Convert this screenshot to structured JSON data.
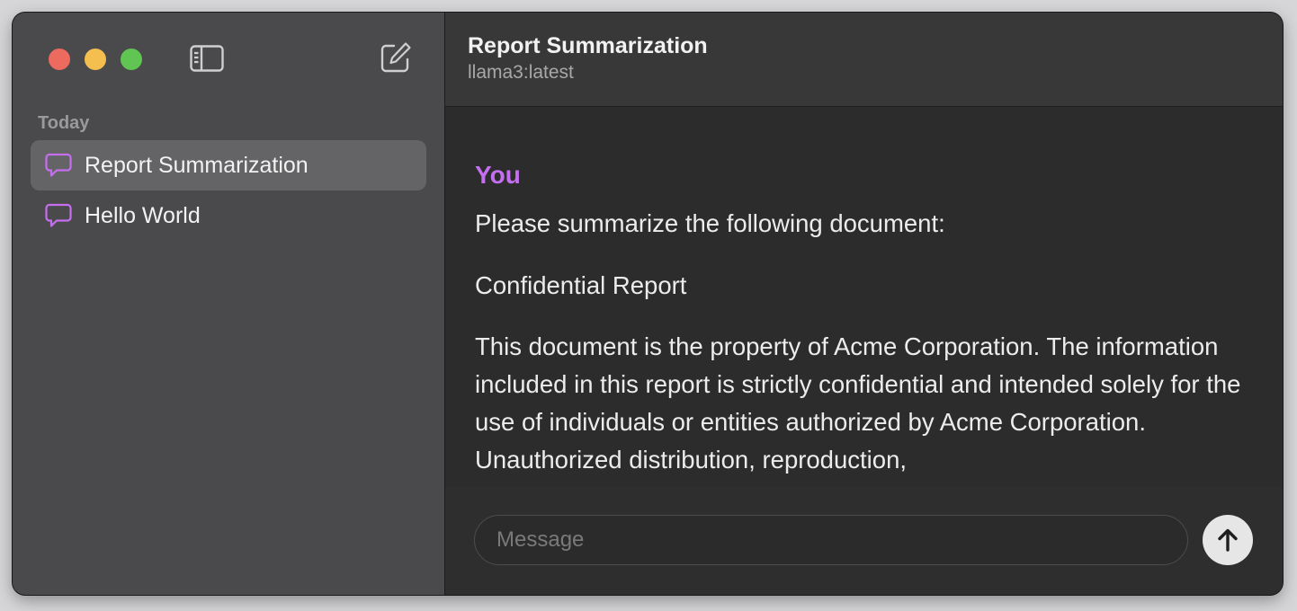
{
  "window": {
    "traffic_lights": {
      "close_color": "#ec6a5e",
      "minimize_color": "#f4bf4f",
      "maximize_color": "#61c554"
    },
    "toolbar": {
      "sidebar_toggle_icon": "sidebar-icon",
      "compose_icon": "compose-icon"
    }
  },
  "sidebar": {
    "section_label": "Today",
    "items": [
      {
        "label": "Report Summarization",
        "icon": "chat-bubble-icon",
        "selected": true
      },
      {
        "label": "Hello World",
        "icon": "chat-bubble-icon",
        "selected": false
      }
    ]
  },
  "header": {
    "title": "Report Summarization",
    "subtitle": "llama3:latest"
  },
  "conversation": {
    "messages": [
      {
        "sender": "You",
        "paragraphs": [
          "Please summarize the following document:",
          "Confidential Report",
          "This document is the property of Acme Corporation. The information included in this report is strictly confidential and intended solely for the use of individuals or entities authorized by Acme Corporation. Unauthorized distribution, reproduction,"
        ]
      }
    ]
  },
  "composer": {
    "placeholder": "Message",
    "value": "",
    "send_icon": "arrow-up-icon"
  },
  "colors": {
    "accent": "#c56ff0",
    "sidebar_bg": "#4a4a4c",
    "selected_item_bg": "#646466",
    "main_bg": "#2c2c2c"
  }
}
